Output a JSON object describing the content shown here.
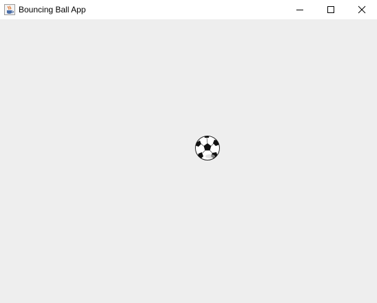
{
  "window": {
    "title": "Bouncing Ball App",
    "app_icon": "java-coffee-cup-icon",
    "controls": [
      "minimize-icon",
      "maximize-icon",
      "close-icon"
    ]
  },
  "canvas": {
    "background": "#eeeeee",
    "ball_icon": "soccer-ball-icon"
  }
}
